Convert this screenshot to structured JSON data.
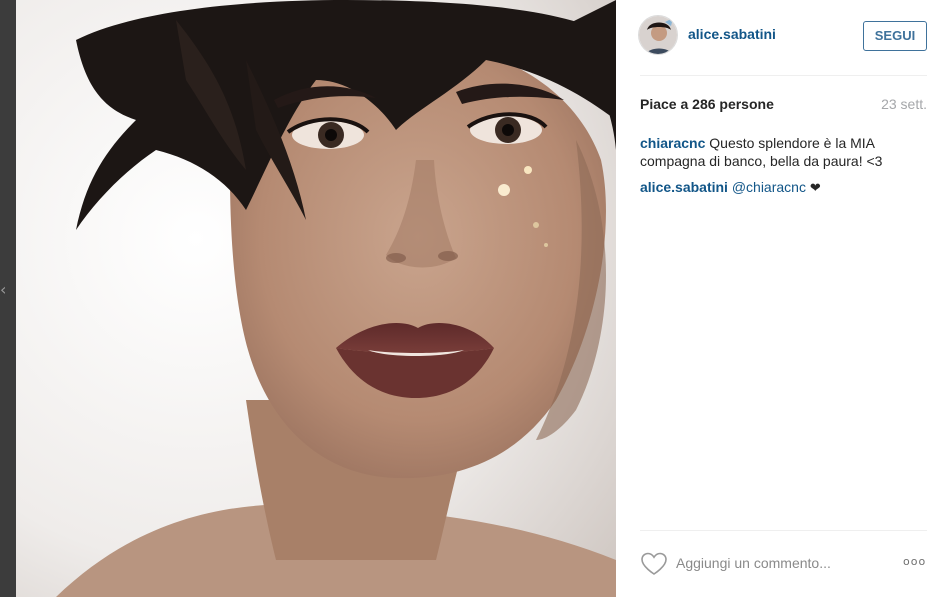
{
  "post": {
    "image_alt": "",
    "author": "alice.sabatini",
    "follow_label": "SEGUI",
    "likes_text": "Piace a 286 persone",
    "date_text": "23 sett."
  },
  "comments": [
    {
      "author": "chiaracnc",
      "text": " Questo splendore è la MIA compagna di banco, bella da paura! <3",
      "mention": "",
      "emoji": ""
    },
    {
      "author": "alice.sabatini",
      "text": " ",
      "mention": "@chiaracnc",
      "emoji": "❤"
    }
  ],
  "footer": {
    "comment_placeholder": "Aggiungi un commento...",
    "more_label": "ooo"
  },
  "overlay": {
    "chevron": "‹"
  },
  "colors": {
    "link": "#125688",
    "follow": "#3f729b",
    "muted": "#a5a7aa"
  },
  "icons": [
    "heart-outline-icon",
    "more-options-icon",
    "chevron-left-icon"
  ]
}
